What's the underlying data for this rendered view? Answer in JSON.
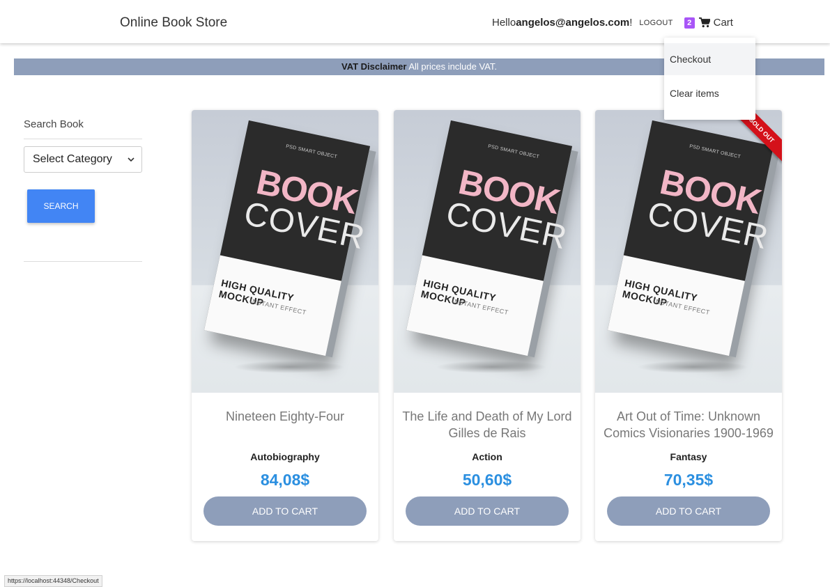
{
  "navbar": {
    "brand": "Online Book Store",
    "greeting": "Hello ",
    "user_email": "angelos@angelos.com",
    "greeting_suffix": "!",
    "logout_label": "LOGOUT",
    "cart_count": "2",
    "cart_label": "Cart"
  },
  "cart_menu": {
    "items": [
      "Checkout",
      "Clear items"
    ]
  },
  "vat": {
    "label": "VAT Disclaimer",
    "text": " All prices include VAT."
  },
  "sidebar": {
    "search_label": "Search Book",
    "category_selected": "Select Category",
    "search_button": "SEARCH"
  },
  "books": [
    {
      "title": "Nineteen Eighty-Four",
      "category": "Autobiography",
      "price": "84,08$",
      "button": "ADD TO CART",
      "sold_out": false
    },
    {
      "title": "The Life and Death of My Lord Gilles de Rais",
      "category": "Action",
      "price": "50,60$",
      "button": "ADD TO CART",
      "sold_out": false
    },
    {
      "title": "Art Out of Time: Unknown Comics Visionaries 1900-1969",
      "category": "Fantasy",
      "price": "70,35$",
      "button": "ADD TO CART",
      "sold_out": true
    }
  ],
  "cover_art": {
    "psd": "PSD SMART OBJECT",
    "line1": "BOOK",
    "line2": "COVER",
    "hq": "HIGH QUALITY MOCKUP",
    "effect": "INSTANT EFFECT"
  },
  "sold_out_label": "SOLD OUT",
  "status_url": "https://localhost:44348/Checkout",
  "colors": {
    "accent_blue": "#4285f4",
    "price_blue": "#2b8fe0",
    "slate_button": "#8e9eba",
    "badge_purple": "#a855f7",
    "ribbon_red": "#d4111a"
  }
}
